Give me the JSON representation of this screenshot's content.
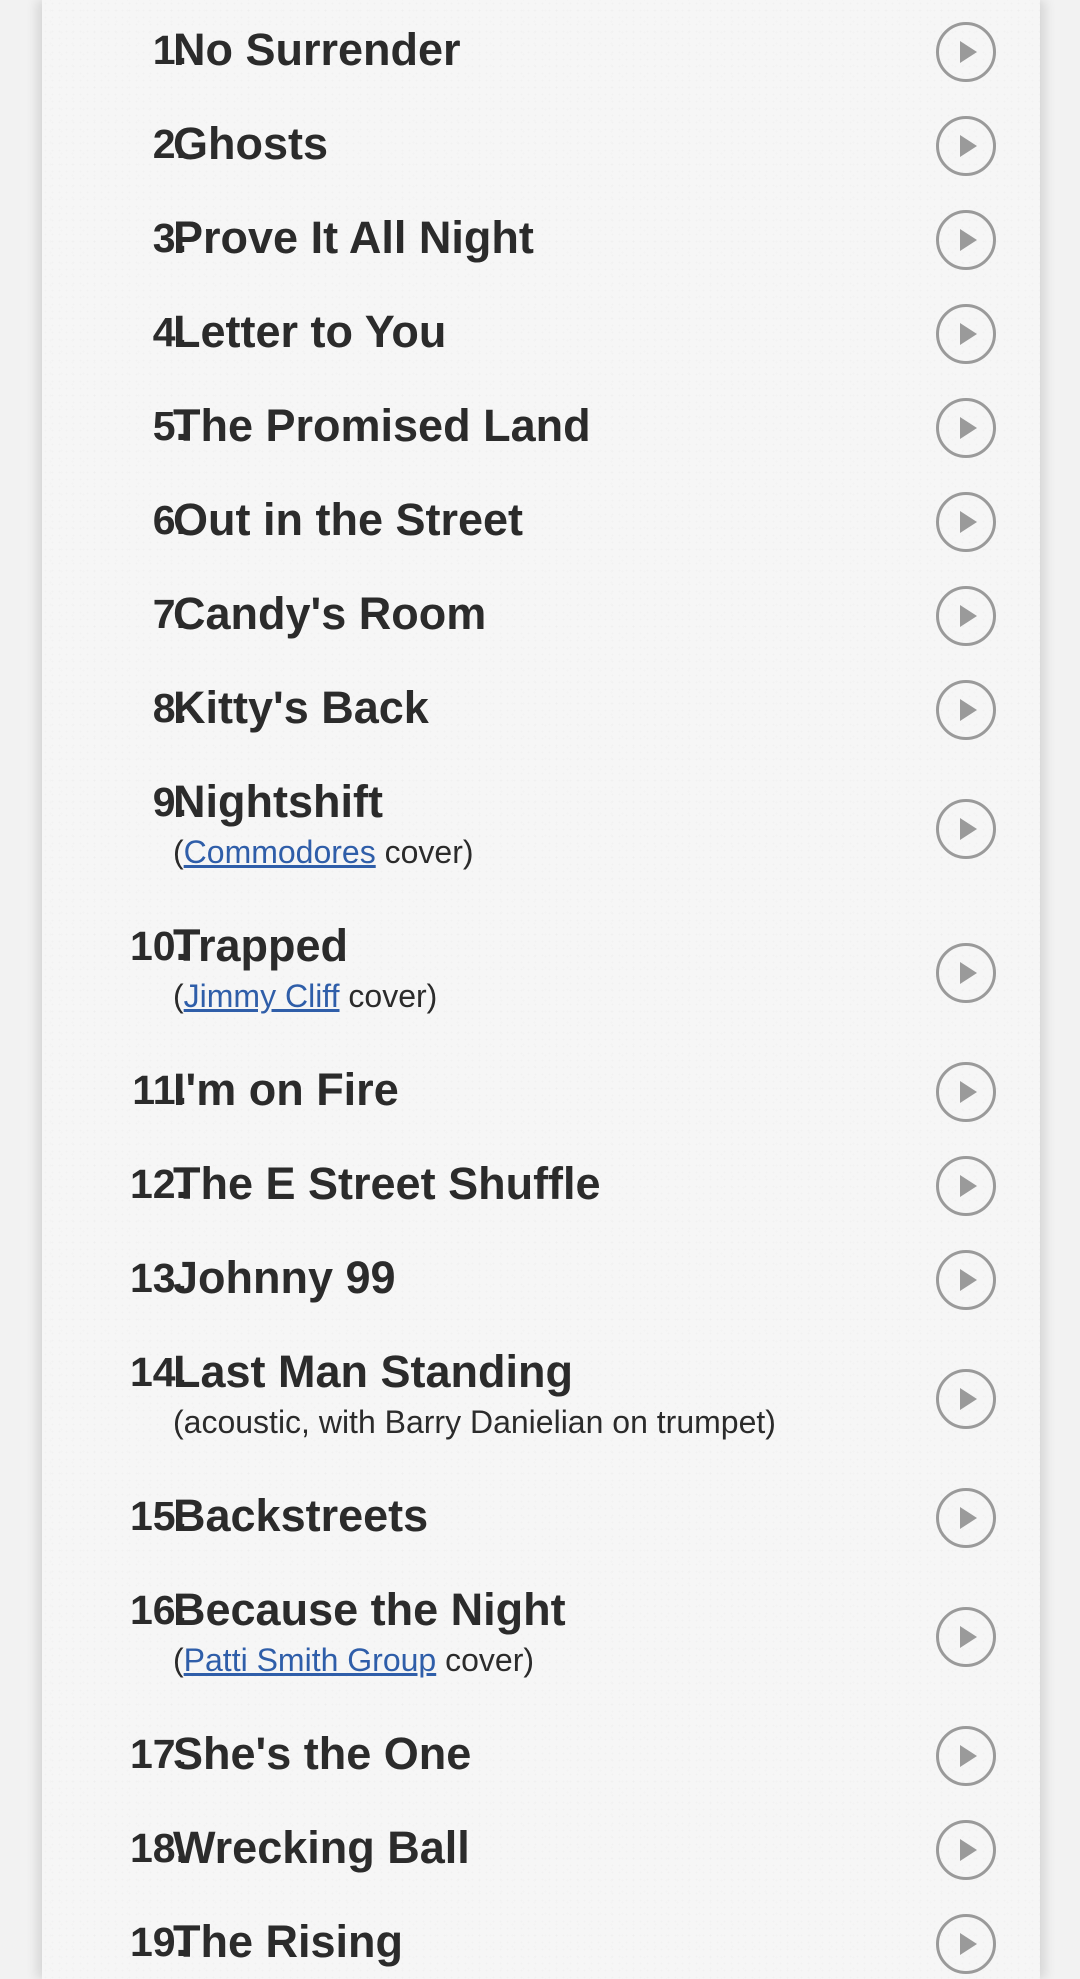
{
  "songs": [
    {
      "number": "1.",
      "title": "No Surrender",
      "note": null
    },
    {
      "number": "2.",
      "title": "Ghosts",
      "note": null
    },
    {
      "number": "3.",
      "title": "Prove It All Night",
      "note": null
    },
    {
      "number": "4.",
      "title": "Letter to You",
      "note": null
    },
    {
      "number": "5.",
      "title": "The Promised Land",
      "note": null
    },
    {
      "number": "6.",
      "title": "Out in the Street",
      "note": null
    },
    {
      "number": "7.",
      "title": "Candy's Room",
      "note": null
    },
    {
      "number": "8.",
      "title": "Kitty's Back",
      "note": null
    },
    {
      "number": "9.",
      "title": "Nightshift",
      "note": {
        "before": "(",
        "link": "Commodores",
        "after": " cover)"
      }
    },
    {
      "number": "10.",
      "title": "Trapped",
      "note": {
        "before": "(",
        "link": "Jimmy Cliff",
        "after": " cover)"
      }
    },
    {
      "number": "11.",
      "title": "I'm on Fire",
      "note": null
    },
    {
      "number": "12.",
      "title": "The E Street Shuffle",
      "note": null
    },
    {
      "number": "13.",
      "title": "Johnny 99",
      "note": null
    },
    {
      "number": "14.",
      "title": "Last Man Standing",
      "note": {
        "before": "(acoustic, with Barry Danielian on trumpet)",
        "link": "",
        "after": ""
      }
    },
    {
      "number": "15.",
      "title": "Backstreets",
      "note": null
    },
    {
      "number": "16.",
      "title": "Because the Night",
      "note": {
        "before": "(",
        "link": "Patti Smith Group",
        "after": " cover)"
      }
    },
    {
      "number": "17.",
      "title": "She's the One",
      "note": null
    },
    {
      "number": "18.",
      "title": "Wrecking Ball",
      "note": null
    },
    {
      "number": "19.",
      "title": "The Rising",
      "note": null
    }
  ],
  "icons": {
    "play": "play-circle-icon"
  },
  "colors": {
    "text": "#2b2b2b",
    "link": "#2f5ea9",
    "icon": "#9a9a9a"
  }
}
